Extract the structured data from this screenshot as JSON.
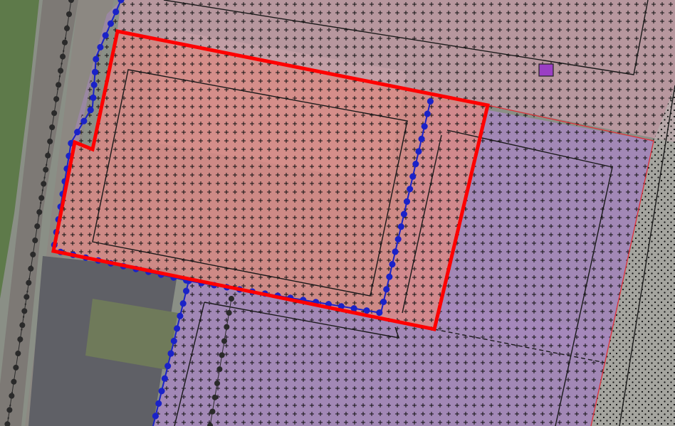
{
  "map": {
    "type": "zoning plan overlay on aerial photo",
    "colors": {
      "aerial_base": "#8a8f86",
      "road": "#7d7975",
      "roof_dark": "#5f6066",
      "vegetation": "#5e7a4a",
      "zone_red": "#d98a86",
      "zone_purple": "#a886c2",
      "zone_pink": "#c69aa6",
      "hatch": "#1a1a1a",
      "plan_boundary": "#ff0000",
      "blue_dotted_line": "#1a22c8",
      "black_dotted_line": "#2a2a2a",
      "thin_red_line": "#e0303a",
      "small_symbol": "#9a3fc4"
    },
    "layers": [
      {
        "id": "aerial-photo",
        "label": ""
      },
      {
        "id": "zone-red",
        "label": ""
      },
      {
        "id": "zone-purple",
        "label": ""
      },
      {
        "id": "zone-pink",
        "label": ""
      },
      {
        "id": "plus-hatch",
        "label": ""
      },
      {
        "id": "dot-hatch",
        "label": ""
      },
      {
        "id": "plan-boundary",
        "label": ""
      },
      {
        "id": "blue-dotted-line",
        "label": ""
      },
      {
        "id": "black-dotted-lines",
        "label": ""
      }
    ]
  }
}
